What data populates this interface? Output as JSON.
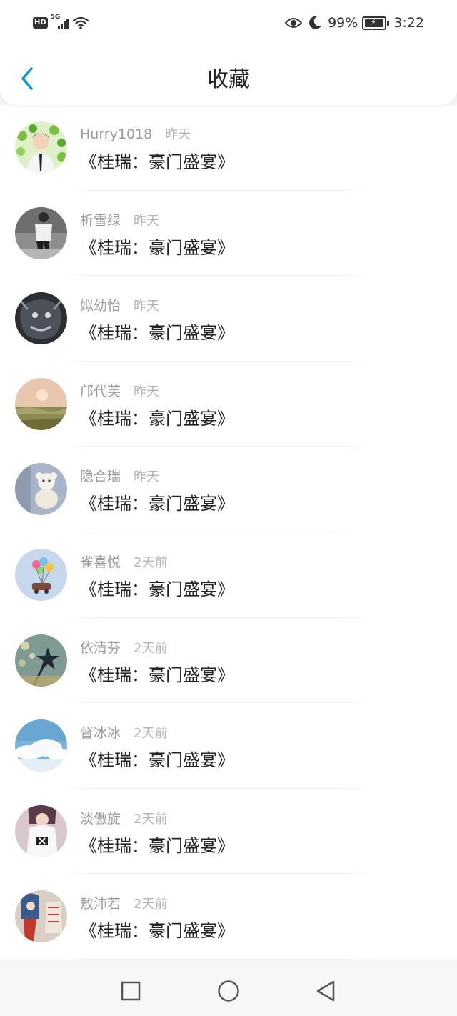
{
  "status_bar": {
    "hd_label": "HD",
    "network_label": "5G",
    "battery_pct": "99%",
    "time": "3:22"
  },
  "header": {
    "title": "收藏",
    "back_icon": "chevron-left-icon",
    "accent_color": "#1296db"
  },
  "favorites": [
    {
      "username": "Hurry1018",
      "time": "昨天",
      "work": "《桂瑞：豪门盛宴》"
    },
    {
      "username": "析雪绿",
      "time": "昨天",
      "work": "《桂瑞：豪门盛宴》"
    },
    {
      "username": "姒幼怡",
      "time": "昨天",
      "work": "《桂瑞：豪门盛宴》"
    },
    {
      "username": "邝代芙",
      "time": "昨天",
      "work": "《桂瑞：豪门盛宴》"
    },
    {
      "username": "隐合瑞",
      "time": "昨天",
      "work": "《桂瑞：豪门盛宴》"
    },
    {
      "username": "雀喜悦",
      "time": "2天前",
      "work": "《桂瑞：豪门盛宴》"
    },
    {
      "username": "依清芬",
      "time": "2天前",
      "work": "《桂瑞：豪门盛宴》"
    },
    {
      "username": "督冰冰",
      "time": "2天前",
      "work": "《桂瑞：豪门盛宴》"
    },
    {
      "username": "淡傲旋",
      "time": "2天前",
      "work": "《桂瑞：豪门盛宴》"
    },
    {
      "username": "敖沛若",
      "time": "2天前",
      "work": "《桂瑞：豪门盛宴》"
    }
  ],
  "bottom_nav": {
    "recent_icon": "square-icon",
    "home_icon": "circle-icon",
    "back_icon": "triangle-back-icon"
  }
}
